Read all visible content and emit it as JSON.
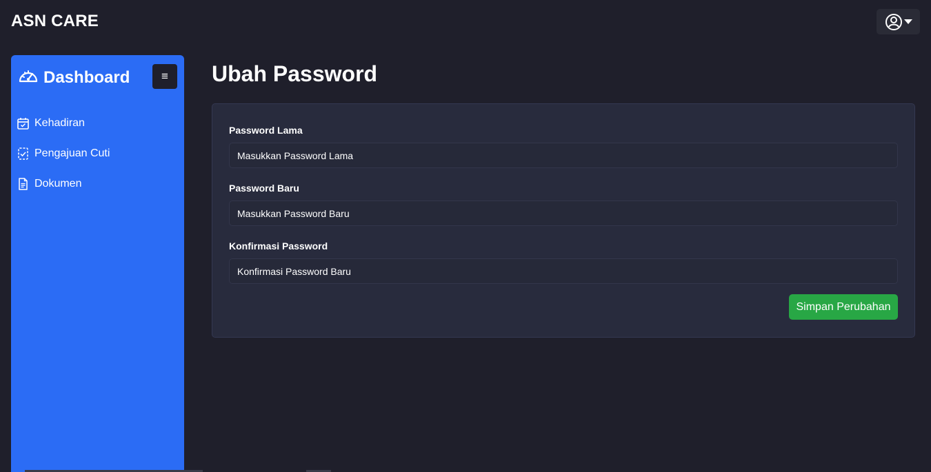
{
  "app": {
    "brand": "ASN CARE"
  },
  "header": {
    "user_menu_icon": "user-circle-icon",
    "user_menu_caret": "caret-down-icon"
  },
  "sidebar": {
    "title": "Dashboard",
    "title_icon": "speedometer-icon",
    "toggle_glyph": "≡",
    "items": [
      {
        "label": "Kehadiran",
        "icon": "calendar-check-icon"
      },
      {
        "label": "Pengajuan Cuti",
        "icon": "checklist-icon"
      },
      {
        "label": "Dokumen",
        "icon": "document-icon"
      }
    ]
  },
  "main": {
    "title": "Ubah Password",
    "form": {
      "fields": [
        {
          "label": "Password Lama",
          "placeholder": "Masukkan Password Lama",
          "value": ""
        },
        {
          "label": "Password Baru",
          "placeholder": "Masukkan Password Baru",
          "value": ""
        },
        {
          "label": "Konfirmasi Password",
          "placeholder": "Konfirmasi Password Baru",
          "value": ""
        }
      ],
      "submit_label": "Simpan Perubahan"
    }
  },
  "colors": {
    "background": "#1f1f2b",
    "sidebar": "#2b6cf5",
    "card": "#282b3d",
    "primary_action": "#28a745"
  }
}
